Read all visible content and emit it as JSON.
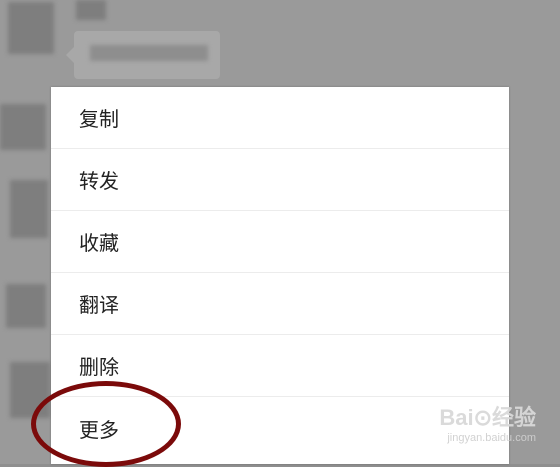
{
  "menu": {
    "items": [
      {
        "label": "复制"
      },
      {
        "label": "转发"
      },
      {
        "label": "收藏"
      },
      {
        "label": "翻译"
      },
      {
        "label": "删除"
      },
      {
        "label": "更多"
      }
    ]
  },
  "watermark": {
    "brand": "Bai⊙经验",
    "url": "jingyan.baidu.com"
  },
  "colors": {
    "overlay": "#9a9a9a",
    "menu_bg": "#ffffff",
    "annotation": "#7b0a0a"
  }
}
